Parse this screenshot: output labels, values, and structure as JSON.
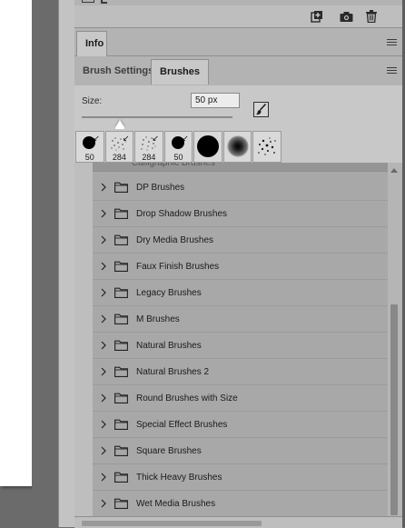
{
  "top_panel": {
    "icons": [
      "new-layer-icon",
      "camera-icon",
      "trash-icon"
    ]
  },
  "info_panel": {
    "tab_label": "Info",
    "menu_icon": "panel-menu-icon"
  },
  "brushes_panel": {
    "tabs": [
      {
        "label": "Brush Settings",
        "active": false
      },
      {
        "label": "Brushes",
        "active": true
      }
    ],
    "size_label": "Size:",
    "size_value": "50 px",
    "size_slider_fraction": 0.25,
    "presets": [
      {
        "icon": "hard-round-brush-icon",
        "size": "50"
      },
      {
        "icon": "spatter-brush-icon",
        "size": "284"
      },
      {
        "icon": "spatter-brush-icon",
        "size": "284"
      },
      {
        "icon": "hard-round-brush-icon",
        "size": "50"
      },
      {
        "icon": "hard-round-large-brush-icon",
        "size": ""
      },
      {
        "icon": "soft-round-brush-icon",
        "size": ""
      },
      {
        "icon": "spatter-brush-icon",
        "size": ""
      }
    ],
    "partially_hidden_item": "Calligraphic Brushes",
    "folders": [
      "DP Brushes",
      "Drop Shadow Brushes",
      "Dry Media Brushes",
      "Faux Finish Brushes",
      "Legacy Brushes",
      "M Brushes",
      "Natural Brushes",
      "Natural Brushes 2",
      "Round Brushes with Size",
      "Special Effect Brushes",
      "Square Brushes",
      "Thick Heavy Brushes",
      "Wet Media Brushes"
    ]
  },
  "colors": {
    "panel_bg": "#bebebe",
    "list_bg": "#a8a8a8",
    "workspace_bg": "#6b6b6b",
    "input_bg": "#ececec"
  }
}
